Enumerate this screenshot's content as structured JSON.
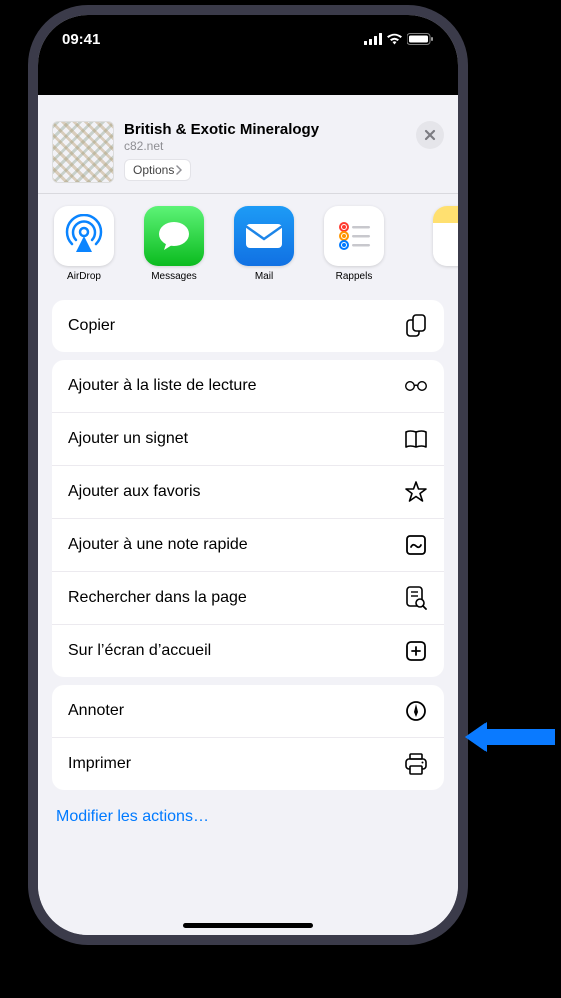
{
  "status": {
    "time": "09:41"
  },
  "header": {
    "title": "British & Exotic Mineralogy",
    "subtitle": "c82.net",
    "options_label": "Options"
  },
  "apps": [
    {
      "name": "airdrop",
      "label": "AirDrop"
    },
    {
      "name": "messages",
      "label": "Messages"
    },
    {
      "name": "mail",
      "label": "Mail"
    },
    {
      "name": "reminders",
      "label": "Rappels"
    }
  ],
  "section1": {
    "copy": "Copier"
  },
  "section2": {
    "reading_list": "Ajouter à la liste de lecture",
    "bookmark": "Ajouter un signet",
    "favorites": "Ajouter aux favoris",
    "quick_note": "Ajouter à une note rapide",
    "find": "Rechercher dans la page",
    "home_screen": "Sur l’écran d’accueil"
  },
  "section3": {
    "annotate": "Annoter",
    "print": "Imprimer"
  },
  "edit_actions": "Modifier les actions…"
}
